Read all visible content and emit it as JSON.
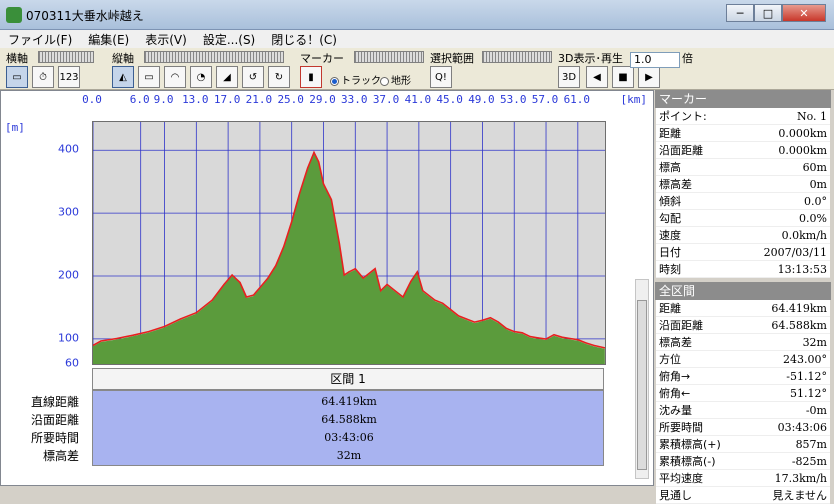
{
  "window": {
    "title": "070311大垂水峠越え",
    "min_label": "─",
    "max_label": "□",
    "close_label": "✕"
  },
  "menu": [
    "ファイル(F)",
    "編集(E)",
    "表示(V)",
    "設定...(S)",
    "閉じる！(C)"
  ],
  "toolbar": {
    "horizontal_axis_label": "横軸",
    "vertical_axis_label": "縦軸",
    "marker_label": "マーカー",
    "selection_label": "選択範囲",
    "display_3d_label": "3D表示･再生",
    "speed_value": "1.0",
    "speed_unit": "倍",
    "track_label": "トラック",
    "terrain_label": "地形",
    "track_selected": true,
    "timer_icon_label": "123",
    "play_3d_label": "3D"
  },
  "chart_data": {
    "type": "area",
    "xlabel": "[km]",
    "ylabel": "[m]",
    "x_ticks": [
      "0.0",
      "6.0",
      "9.0",
      "13.0",
      "17.0",
      "21.0",
      "25.0",
      "29.0",
      "33.0",
      "37.0",
      "41.0",
      "45.0",
      "49.0",
      "53.0",
      "57.0",
      "61.0"
    ],
    "y_ticks": [
      "400",
      "300",
      "200",
      "100",
      "60"
    ],
    "y_range": [
      60,
      445
    ],
    "x_range": [
      0,
      64.42
    ],
    "colors": {
      "fill": "#5b9b3c",
      "line": "#e8201f",
      "grid": "#2f34c9",
      "background": "#d9d9d9"
    },
    "series": [
      {
        "name": "",
        "points": [
          [
            0,
            88
          ],
          [
            1,
            95
          ],
          [
            3,
            99
          ],
          [
            5,
            104
          ],
          [
            7,
            110
          ],
          [
            9,
            118
          ],
          [
            11,
            130
          ],
          [
            13,
            140
          ],
          [
            15,
            160
          ],
          [
            16.5,
            185
          ],
          [
            17.5,
            200
          ],
          [
            18.5,
            188
          ],
          [
            19.3,
            165
          ],
          [
            20.2,
            168
          ],
          [
            21,
            180
          ],
          [
            22,
            195
          ],
          [
            23,
            215
          ],
          [
            24,
            245
          ],
          [
            25,
            285
          ],
          [
            26,
            330
          ],
          [
            27,
            370
          ],
          [
            27.8,
            395
          ],
          [
            28.4,
            380
          ],
          [
            29,
            345
          ],
          [
            30,
            320
          ],
          [
            31,
            250
          ],
          [
            31.6,
            200
          ],
          [
            32.2,
            205
          ],
          [
            33,
            210
          ],
          [
            34,
            195
          ],
          [
            35.5,
            210
          ],
          [
            36.2,
            175
          ],
          [
            37,
            185
          ],
          [
            38,
            175
          ],
          [
            39,
            165
          ],
          [
            40,
            190
          ],
          [
            40.8,
            205
          ],
          [
            41.5,
            175
          ],
          [
            43,
            160
          ],
          [
            44,
            155
          ],
          [
            45,
            145
          ],
          [
            46,
            135
          ],
          [
            47,
            130
          ],
          [
            48,
            125
          ],
          [
            49,
            128
          ],
          [
            50,
            132
          ],
          [
            51,
            125
          ],
          [
            52,
            115
          ],
          [
            53,
            110
          ],
          [
            54,
            108
          ],
          [
            55,
            102
          ],
          [
            56,
            100
          ],
          [
            57,
            98
          ],
          [
            58,
            105
          ],
          [
            59,
            101
          ],
          [
            60,
            99
          ],
          [
            61,
            97
          ],
          [
            62,
            92
          ],
          [
            63,
            88
          ],
          [
            64.4,
            84
          ]
        ]
      }
    ]
  },
  "section": {
    "title": "区間 1"
  },
  "summary": [
    {
      "label": "直線距離",
      "value": "64.419km"
    },
    {
      "label": "沿面距離",
      "value": "64.588km"
    },
    {
      "label": "所要時間",
      "value": "03:43:06"
    },
    {
      "label": "標高差",
      "value": "32m"
    }
  ],
  "marker_panel": {
    "title": "マーカー",
    "rows": [
      {
        "k": "ポイント:",
        "v": "No. 1"
      },
      {
        "k": "距離",
        "v": "0.000km"
      },
      {
        "k": "沿面距離",
        "v": "0.000km"
      },
      {
        "k": "標高",
        "v": "60m"
      },
      {
        "k": "標高差",
        "v": "0m"
      },
      {
        "k": "傾斜",
        "v": "0.0°"
      },
      {
        "k": "勾配",
        "v": "0.0%"
      },
      {
        "k": "速度",
        "v": "0.0km/h"
      },
      {
        "k": "日付",
        "v": "2007/03/11"
      },
      {
        "k": "時刻",
        "v": "13:13:53"
      }
    ]
  },
  "total_panel": {
    "title": "全区間",
    "rows": [
      {
        "k": "距離",
        "v": "64.419km"
      },
      {
        "k": "沿面距離",
        "v": "64.588km"
      },
      {
        "k": "標高差",
        "v": "32m"
      },
      {
        "k": "方位",
        "v": "243.00°"
      },
      {
        "k": "俯角→",
        "v": "-51.12°"
      },
      {
        "k": "俯角←",
        "v": "51.12°"
      },
      {
        "k": "沈み量",
        "v": "-0m"
      },
      {
        "k": "所要時間",
        "v": "03:43:06"
      },
      {
        "k": "累積標高(+)",
        "v": "857m"
      },
      {
        "k": "累積標高(-)",
        "v": "-825m"
      },
      {
        "k": "平均速度",
        "v": "17.3km/h"
      },
      {
        "k": "見通し",
        "v": "見えません"
      }
    ]
  }
}
